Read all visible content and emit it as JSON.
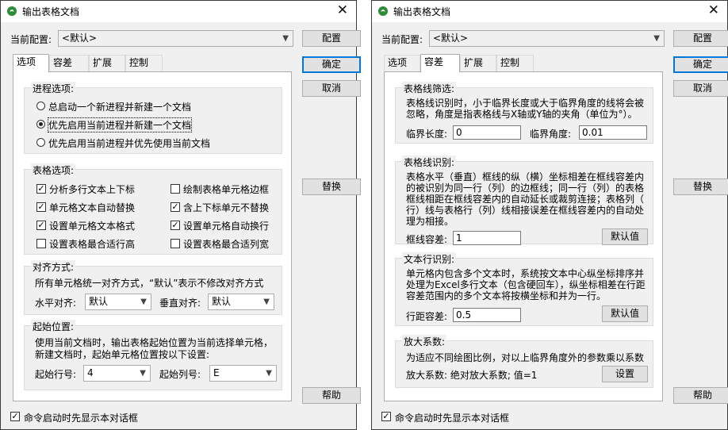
{
  "left": {
    "title": "输出表格文档",
    "config_label": "当前配置:",
    "config_value": "<默认>",
    "config_button": "配置",
    "tabs": [
      "选项",
      "容差",
      "扩展",
      "控制"
    ],
    "ok": "确定",
    "cancel": "取消",
    "replace": "替换",
    "help": "帮助",
    "footer_check": "命令启动时先显示本对话框",
    "process": {
      "title": "进程选项:",
      "options": [
        "总启动一个新进程并新建一个文档",
        "优先启用当前进程并新建一个文档",
        "优先启用当前进程并优先使用当前文档"
      ],
      "selected": 1
    },
    "table": {
      "title": "表格选项:",
      "checks": [
        {
          "label": "分析多行文本上下标",
          "checked": true
        },
        {
          "label": "绘制表格单元格边框",
          "checked": false
        },
        {
          "label": "单元格文本自动替换",
          "checked": true
        },
        {
          "label": "含上下标单元不替换",
          "checked": true
        },
        {
          "label": "设置单元格文本格式",
          "checked": true
        },
        {
          "label": "设置单元格自动换行",
          "checked": true
        },
        {
          "label": "设置表格最合适行高",
          "checked": false
        },
        {
          "label": "设置表格最合适列宽",
          "checked": false
        }
      ]
    },
    "align": {
      "title": "对齐方式:",
      "desc": "所有单元格统一对齐方式，“默认”表示不修改对齐方式",
      "h_label": "水平对齐:",
      "h_value": "默认",
      "v_label": "垂直对齐:",
      "v_value": "默认"
    },
    "start": {
      "title": "起始位置:",
      "desc1": "使用当前文档时，输出表格起始位置为当前选择单元格，",
      "desc2": "新建文档时，起始单元格位置按以下设置:",
      "row_label": "起始行号:",
      "row_value": "4",
      "col_label": "起始列号:",
      "col_value": "E"
    }
  },
  "right": {
    "title": "输出表格文档",
    "config_label": "当前配置:",
    "config_value": "<默认>",
    "config_button": "配置",
    "tabs": [
      "选项",
      "容差",
      "扩展",
      "控制"
    ],
    "ok": "确定",
    "cancel": "取消",
    "replace": "替换",
    "help": "帮助",
    "footer_check": "命令启动时先显示本对话框",
    "filter": {
      "title": "表格线筛选:",
      "desc1": "表格线识别时，小于临界长度或大于临界角度的线将会被",
      "desc2": "忽略，角度是指表格线与X轴或Y轴的夹角（单位为°）。",
      "len_label": "临界长度:",
      "len_value": "0",
      "ang_label": "临界角度:",
      "ang_value": "0.01"
    },
    "recog": {
      "title": "表格线识别:",
      "desc1": "表格水平（垂直）框线的纵（横）坐标相差在框线容差内",
      "desc2": "的被识别为同一行（列）的边框线；同一行（列）的表格",
      "desc3": "框线相距在框线容差内的自动延长或裁剪连接；表格列（",
      "desc4": "行）线与表格行（列）线相接误差在框线容差内的自动处",
      "desc5": "理为相接。",
      "tol_label": "框线容差:",
      "tol_value": "1",
      "default_btn": "默认值"
    },
    "text": {
      "title": "文本行识别:",
      "desc1": "单元格内包含多个文本时，系统按文本中心纵坐标排序并",
      "desc2": "处理为Excel多行文本（包含硬回车），纵坐标相差在行距",
      "desc3": "容差范围内的多个文本将按横坐标和并为一行。",
      "tol_label": "行距容差:",
      "tol_value": "0.5",
      "default_btn": "默认值"
    },
    "scale": {
      "title": "放大系数:",
      "desc": "为适应不同绘图比例，对以上临界角度外的参数乘以系数",
      "value_label": "放大系数: 绝对放大系数; 值=1",
      "set_btn": "设置"
    }
  }
}
